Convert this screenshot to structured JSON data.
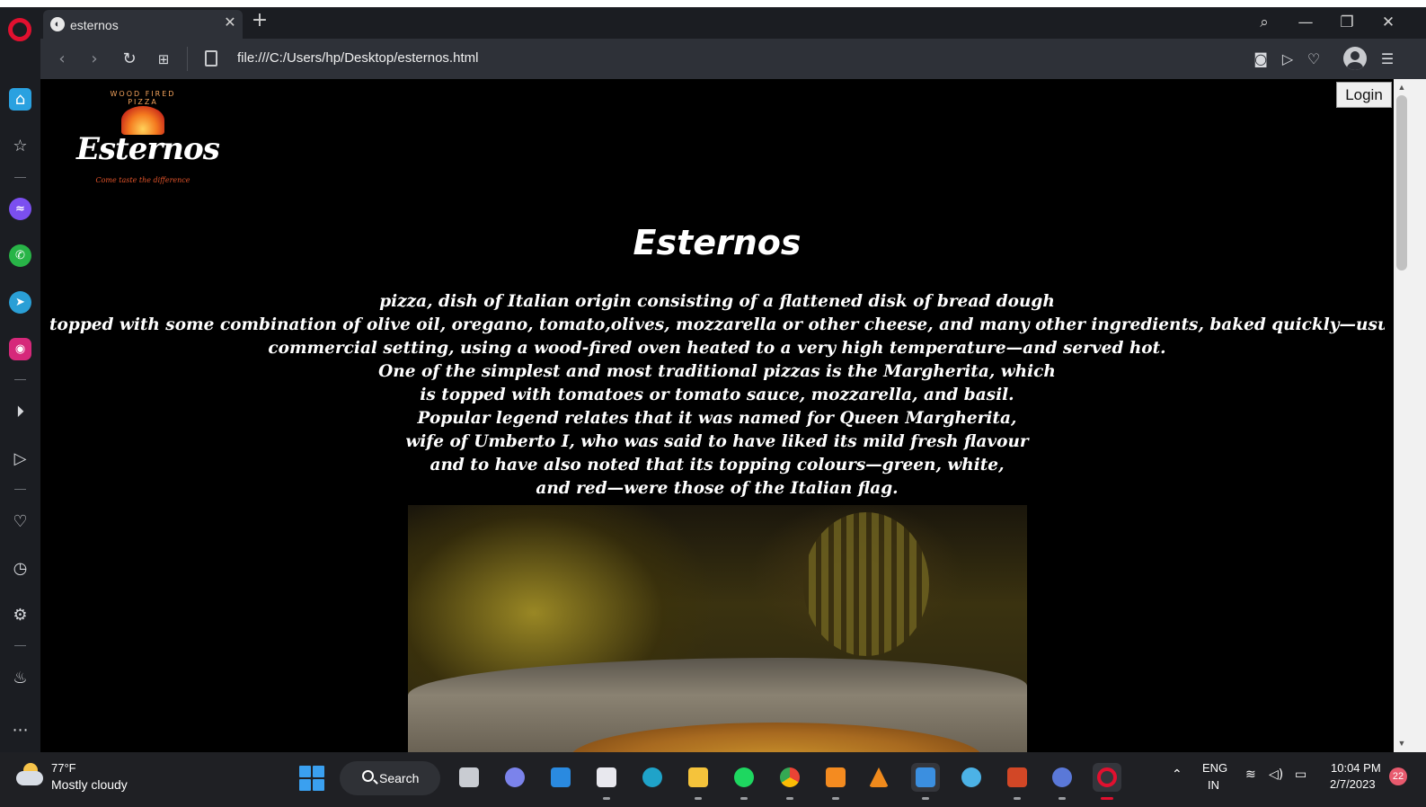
{
  "browser": {
    "tab_title": "esternos",
    "tab_close": "✕",
    "new_tab": "+",
    "url": "file:///C:/Users/hp/Desktop/esternos.html",
    "window_controls": {
      "search": "⌕",
      "minimize": "—",
      "restore": "❐",
      "close": "✕"
    },
    "toolbar_icons": [
      "back-icon",
      "forward-icon",
      "reload-icon",
      "tab-grid-icon",
      "page-info-icon",
      "snapshot-icon",
      "send-icon",
      "heart-icon",
      "profile-icon",
      "easy-setup-icon"
    ]
  },
  "sidebar": {
    "items": [
      "opera-logo",
      "home-icon",
      "bookmarks-icon",
      "messenger-icon",
      "whatsapp-icon",
      "telegram-icon",
      "instagram-icon",
      "player-icon",
      "flow-icon",
      "favorites-icon",
      "history-icon",
      "settings-icon",
      "tips-icon",
      "more-icon"
    ]
  },
  "page": {
    "logo": {
      "arc_text": "WOOD FIRED PIZZA",
      "script": "Esternos",
      "tagline": "Come taste the difference"
    },
    "login_label": "Login",
    "title": "Esternos",
    "paragraph_lines": [
      "pizza, dish of Italian origin consisting of a flattened disk of bread dough",
      "topped with some combination of olive oil, oregano, tomato,olives, mozzarella or other cheese, and many other ingredients, baked quickly—usually, in a",
      "commercial setting, using a wood-fired oven heated to a very high temperature—and served hot.",
      "One of the simplest and most traditional pizzas is the Margherita, which",
      "is topped with tomatoes or tomato sauce, mozzarella, and basil.",
      "Popular legend relates that it was named for Queen Margherita,",
      "wife of Umberto I, who was said to have liked its mild fresh flavour",
      "and to have also noted that its topping colours—green, white,",
      "and red—were those of the Italian flag."
    ]
  },
  "taskbar": {
    "weather_temp": "77°F",
    "weather_desc": "Mostly cloudy",
    "search_label": "Search",
    "apps": [
      "task-view-icon",
      "teams-chat-icon",
      "mail-icon",
      "snipping-tool-icon",
      "edge-icon",
      "file-explorer-icon",
      "spotify-icon",
      "chrome-icon",
      "sublime-text-icon",
      "vlc-icon",
      "photos-icon",
      "paint-icon",
      "powerpoint-icon",
      "media-app-icon",
      "opera-icon"
    ],
    "lang_line1": "ENG",
    "lang_line2": "IN",
    "time": "10:04 PM",
    "date": "2/7/2023",
    "notification_count": "22"
  },
  "colors": {
    "page_bg": "#000000",
    "sidebar_bg": "#1b1d22",
    "toolbar_bg": "#2e3138",
    "taskbar_bg": "#1f2024",
    "opera_red": "#e1102f",
    "windows_blue": "#3aa0f0"
  }
}
